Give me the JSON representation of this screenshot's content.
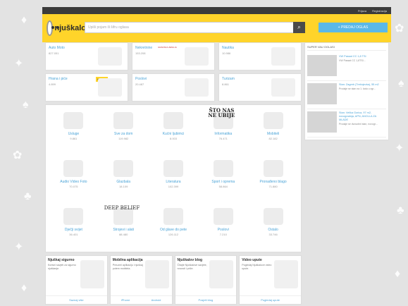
{
  "topbar": {
    "login": "Prijava",
    "register": "Registracija"
  },
  "header": {
    "logo_text": "njuškalo",
    "search_placeholder": "Upiši pojam ili šifru oglasa",
    "post_button": "+ PREDAJ OGLAS"
  },
  "top_categories": [
    {
      "name": "Auto Moto",
      "count": "827.051"
    },
    {
      "name": "Nekretnine",
      "count": "153.208",
      "annotation": "GRADSKA ZEMLJA"
    },
    {
      "name": "Nautika",
      "count": "10.986"
    },
    {
      "name": "Hrana i piće",
      "count": "4.899",
      "badge": "NOVO!"
    },
    {
      "name": "Poslovi",
      "count": "20.487"
    },
    {
      "name": "Turizam",
      "count": "8.861"
    }
  ],
  "grid_categories": [
    {
      "name": "Usluge",
      "count": "9.861"
    },
    {
      "name": "Sve za dom",
      "count": "119.982"
    },
    {
      "name": "Kućni ljubimci",
      "count": "8.003"
    },
    {
      "name": "Informatika",
      "count": "76.471",
      "overlay": [
        "ŠTO NAS",
        "NE UBIJE"
      ]
    },
    {
      "name": "Mobiteli",
      "count": "82.182"
    },
    {
      "name": "Audio Video Foto",
      "count": "70.075"
    },
    {
      "name": "Glazbala",
      "count": "18.109"
    },
    {
      "name": "Literatura",
      "count": "102.399"
    },
    {
      "name": "Sport i oprema",
      "count": "58.864"
    },
    {
      "name": "Pronađeno blago",
      "count": "71.880"
    },
    {
      "name": "Dječji svijet",
      "count": "36.401"
    },
    {
      "name": "Strojevi i alati",
      "count": "88.480",
      "overlay": [
        "DEEP BELIEF"
      ]
    },
    {
      "name": "Od glave do pete",
      "count": "126.112"
    },
    {
      "name": "Poslovi",
      "count": "7.210"
    },
    {
      "name": "Ostalo",
      "count": "33.746"
    }
  ],
  "promos": [
    {
      "title": "Njuškaj sigurno",
      "text": "Korisni savjeti za sigurno njuškanje.",
      "link": "Saznaj više"
    },
    {
      "title": "Mobilna aplikacija",
      "text": "Preuzmi aplikaciju i njuškaj putem mobitela.",
      "links": [
        "iPhone",
        "Android"
      ]
    },
    {
      "title": "Njuškalov blog",
      "text": "Čitajte Njuškalove savjete, novosti i priče.",
      "link": "Posjeti blog"
    },
    {
      "title": "Video upute",
      "text": "Pogledaj Njuškalove video upute.",
      "link": "Pogledaj upute"
    }
  ],
  "featured": {
    "title": "SUPER VAU OGLASI",
    "items": [
      {
        "title": "VW Passat CC 1,8 TSI",
        "desc": "VW Passat CC 1,8TSI..."
      },
      {
        "title": "Stan: Zagreb (Trešnjevka), 55 m2",
        "desc": "Prodaje se stan na 1. katu u zgr..."
      },
      {
        "title": "Stan: Velika Gorica, 97 m2, novogradnja, APN, ANOLLA ZA MLADE",
        "desc": "Prodaje se dvosobni stan, novogr..."
      }
    ]
  },
  "colors": {
    "brand_yellow": "#ffd42a",
    "link_blue": "#4aa3d7",
    "post_button": "#5bb8e8"
  }
}
